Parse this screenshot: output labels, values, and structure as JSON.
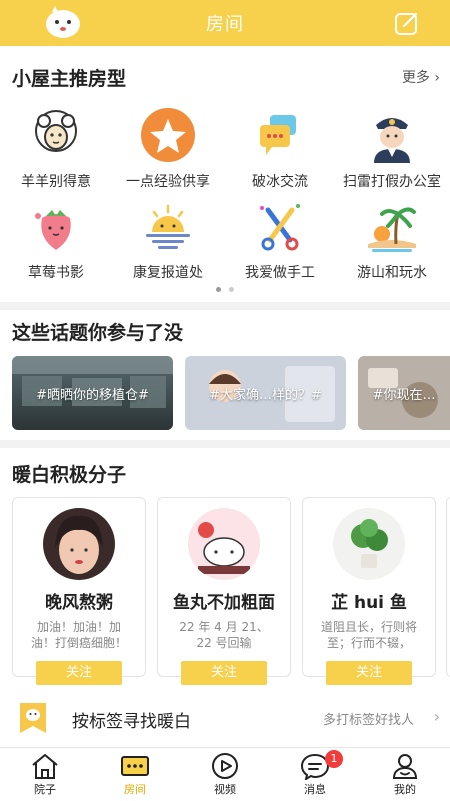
{
  "header": {
    "title": "房间"
  },
  "recommend": {
    "title": "小屋主推房型",
    "more": "更多 ›",
    "items": [
      {
        "label": "羊羊别得意",
        "icon": "sheep-icon"
      },
      {
        "label": "一点经验供享",
        "icon": "star-icon"
      },
      {
        "label": "破冰交流",
        "icon": "chat-bubbles-icon"
      },
      {
        "label": "扫雷打假办公室",
        "icon": "police-icon"
      },
      {
        "label": "草莓书影",
        "icon": "strawberry-icon"
      },
      {
        "label": "康复报道处",
        "icon": "sunrise-icon"
      },
      {
        "label": "我爱做手工",
        "icon": "scissors-icon"
      },
      {
        "label": "游山和玩水",
        "icon": "palm-island-icon"
      }
    ]
  },
  "topics": {
    "title": "这些话题你参与了没",
    "items": [
      {
        "label": "#晒晒你的移植仓#"
      },
      {
        "label": "#大家确…样的？#"
      },
      {
        "label": "#你现在…"
      }
    ]
  },
  "members": {
    "title": "暖白积极分子",
    "items": [
      {
        "name": "晚风熬粥",
        "desc": "加油！加油！加油！打倒癌细胞！一定…",
        "button": "关注"
      },
      {
        "name": "鱼丸不加粗面",
        "desc": "22 年 4 月 21、22 号回输",
        "button": "关注"
      },
      {
        "name": "芷 hui 鱼",
        "desc": "道阻且长，行则将至；行而不辍，未…",
        "button": "关注"
      }
    ]
  },
  "tag_search": {
    "title": "按标签寻找暖白",
    "hint": "多打标签好找人"
  },
  "tabbar": {
    "items": [
      {
        "label": "院子"
      },
      {
        "label": "房间"
      },
      {
        "label": "视频"
      },
      {
        "label": "消息",
        "badge": "1"
      },
      {
        "label": "我的"
      }
    ]
  },
  "colors": {
    "accent": "#f7d04c",
    "badge": "#f23c3c"
  }
}
